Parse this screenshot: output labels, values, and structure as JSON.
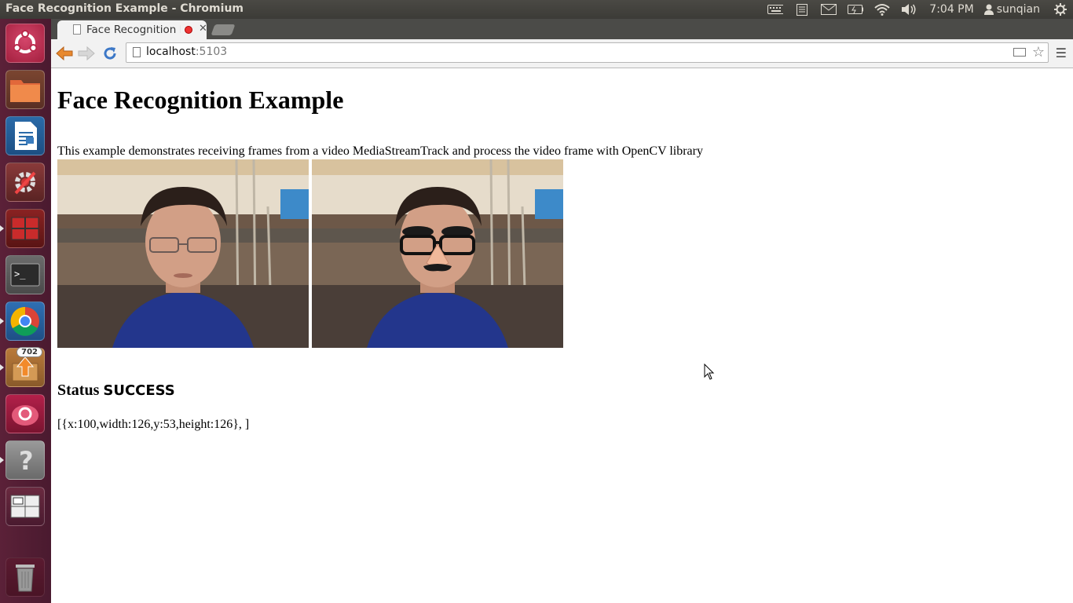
{
  "window": {
    "title": "Face Recognition Example - Chromium"
  },
  "tray": {
    "time": "7:04 PM",
    "user": "sunqian"
  },
  "launcher": {
    "badge_count": "702"
  },
  "browser": {
    "tab_title": "Face Recognition Example",
    "url_host": "localhost",
    "url_port": ":5103"
  },
  "page": {
    "heading": "Face Recognition Example",
    "description": "This example demonstrates receiving frames from a video MediaStreamTrack and process the video frame with OpenCV library",
    "status_label": "Status",
    "status_value": "SUCCESS",
    "result": "[{x:100,width:126,y:53,height:126}, ]"
  }
}
